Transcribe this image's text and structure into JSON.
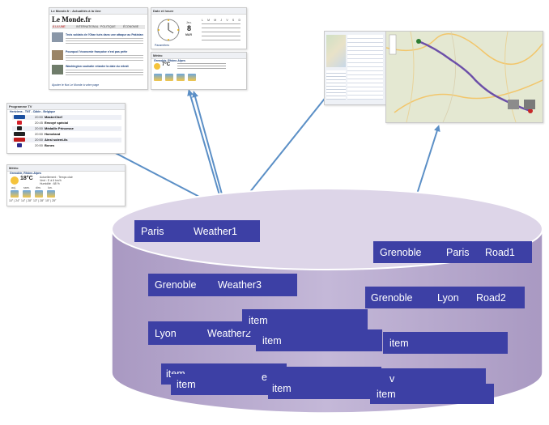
{
  "newspaper": {
    "header_label": "Le Monde.fr : Actualités à la Une",
    "logo": "Le Monde.fr",
    "tabs": [
      "À LA UNE",
      "INTERNATIONAL",
      "POLITIQUE",
      "ÉCONOMIE"
    ],
    "headlines": [
      "Trois soldats de l'Otan tués dans une attaque au Pakistan",
      "Pourquoi l'économie française n'est pas prête",
      "Washington souhaite retarder la date du retrait"
    ],
    "footer": "Ajouter le flux Le Monde à votre page"
  },
  "calendar": {
    "header_label": "Date et heure",
    "day_name": "Jeu.",
    "day_number": "8",
    "month": "MAR",
    "weekdays": [
      "L",
      "M",
      "M",
      "J",
      "V",
      "S",
      "D"
    ],
    "footer": "Paramètres"
  },
  "meteo_small": {
    "header_label": "Météo",
    "city": "Grenoble, Rhône-Alpes",
    "temp": "7°C"
  },
  "programmes_tv": {
    "header_label": "Programme TV",
    "subtitle": "Hertziens - TNT - Câble - Belgique",
    "rows": [
      {
        "channel": "TF1",
        "time": "20:50",
        "title": "MasterChef",
        "color": "#1a4fa0"
      },
      {
        "channel": "France 2",
        "time": "20:45",
        "title": "Envoyé spécial",
        "color": "#d4202a"
      },
      {
        "channel": "Canal+",
        "time": "20:50",
        "title": "Médaille Princesse",
        "color": "#222222"
      },
      {
        "channel": "Canal+",
        "time": "20:50",
        "title": "Homeland",
        "color": "#222222"
      },
      {
        "channel": "arte",
        "time": "20:50",
        "title": "Ainsi soient-ils",
        "color": "#c21a1a"
      },
      {
        "channel": "M6",
        "time": "20:50",
        "title": "Bones",
        "color": "#2a2a8a"
      }
    ]
  },
  "meteo": {
    "header_label": "Météo",
    "city": "Grenoble, Rhône-Alpes",
    "temp": "18°C",
    "condition": "Actuellement : Temps clair",
    "wind": "Vent : E à 6 km/h",
    "humidity": "Humidité : 68 %",
    "forecast_days": [
      "auj.",
      "sam.",
      "dim.",
      "lun."
    ],
    "forecast_temps": [
      "10° | 24°",
      "14° | 28°",
      "13° | 28°",
      "15° | 25°"
    ]
  },
  "database": {
    "fill_color": "#bbaed0",
    "top_color": "#ddd5e8",
    "tag_color": "#3d40a5",
    "records": [
      [
        "Paris",
        "Weather1"
      ],
      [
        "Grenoble",
        "Paris",
        "Road1"
      ],
      [
        "Grenoble",
        "Weather3"
      ],
      [
        "Grenoble",
        "Lyon",
        "Road2"
      ],
      [
        "item"
      ],
      [
        "Lyon",
        "Weather2"
      ],
      [
        "item"
      ],
      [
        "item"
      ],
      [
        "item"
      ],
      [
        "item"
      ],
      [
        "e"
      ],
      [
        "item"
      ],
      [
        "v"
      ],
      [
        "item"
      ]
    ]
  }
}
